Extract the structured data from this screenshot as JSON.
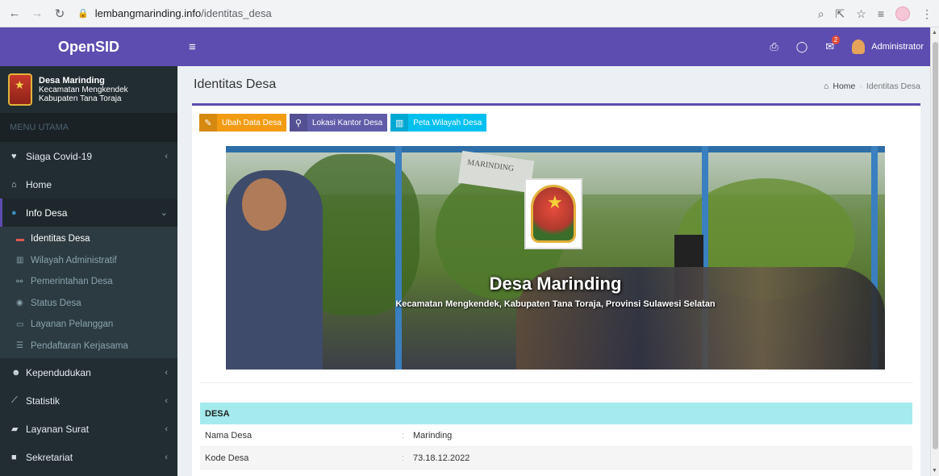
{
  "browser": {
    "url_domain": "lembangmarinding.info",
    "url_path": "/identitas_desa"
  },
  "app": {
    "logo": "OpenSID",
    "village_name": "Desa Marinding",
    "district": "Kecamatan Mengkendek",
    "regency": "Kabupaten Tana Toraja"
  },
  "sidebar": {
    "header": "MENU UTAMA",
    "items": [
      {
        "label": "Siaga Covid-19",
        "icon": "heartbeat-icon"
      },
      {
        "label": "Home",
        "icon": "home-icon"
      },
      {
        "label": "Info Desa",
        "icon": "globe-icon"
      },
      {
        "label": "Kependudukan",
        "icon": "users-icon"
      },
      {
        "label": "Statistik",
        "icon": "line-chart-icon"
      },
      {
        "label": "Layanan Surat",
        "icon": "book-icon"
      },
      {
        "label": "Sekretariat",
        "icon": "archive-icon"
      }
    ],
    "submenu": [
      {
        "label": "Identitas Desa",
        "icon": "id-card-icon"
      },
      {
        "label": "Wilayah Administratif",
        "icon": "map-icon"
      },
      {
        "label": "Pemerintahan Desa",
        "icon": "sitemap-icon"
      },
      {
        "label": "Status Desa",
        "icon": "dot-circle-icon"
      },
      {
        "label": "Layanan Pelanggan",
        "icon": "credit-card-icon"
      },
      {
        "label": "Pendaftaran Kerjasama",
        "icon": "list-icon"
      }
    ]
  },
  "topbar": {
    "notification_count": "2",
    "user": "Administrator"
  },
  "content": {
    "title": "Identitas Desa",
    "breadcrumb_home": "Home",
    "breadcrumb_current": "Identitas Desa",
    "buttons": {
      "edit": "Ubah Data Desa",
      "office": "Lokasi Kantor Desa",
      "map": "Peta Wilayah Desa"
    },
    "hero": {
      "sign_text": "MARINDING",
      "title": "Desa Marinding",
      "subtitle": "Kecamatan Mengkendek, Kabupaten Tana Toraja, Provinsi Sulawesi Selatan"
    },
    "section": "DESA",
    "rows": [
      {
        "label": "Nama Desa",
        "value": "Marinding"
      },
      {
        "label": "Kode Desa",
        "value": "73.18.12.2022"
      }
    ]
  },
  "colors": {
    "brand": "#5d4db0",
    "sidebar_bg": "#222d32",
    "btn_orange": "#f39c12",
    "btn_purple": "#605ca8",
    "btn_cyan": "#00c0ef",
    "section_bg": "#a5ebed"
  }
}
